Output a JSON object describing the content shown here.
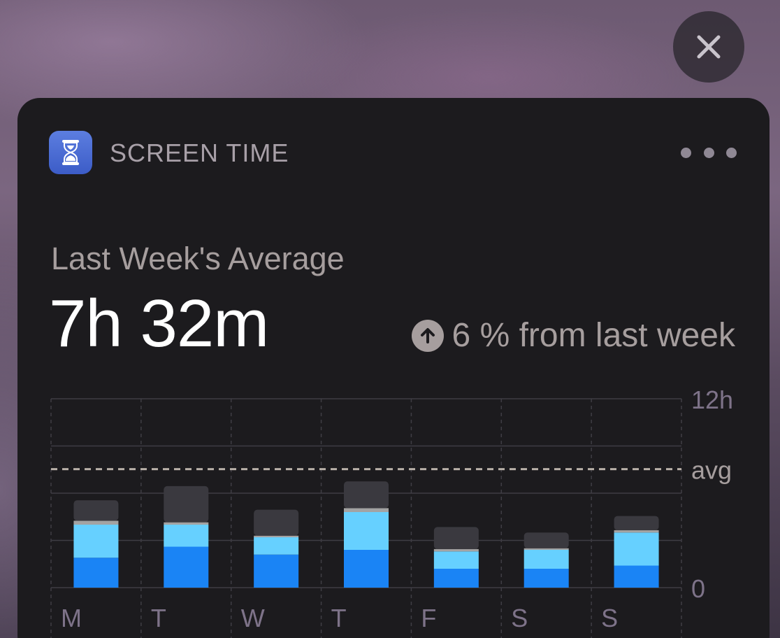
{
  "widget": {
    "app_name": "SCREEN TIME",
    "subtitle": "Last Week's Average",
    "value": "7h 32m",
    "change_text": "6 % from last week",
    "change_direction": "up",
    "icons": {
      "app": "hourglass-icon",
      "close": "close-icon",
      "more": "ellipsis-icon",
      "change": "arrow-up-circle-icon"
    }
  },
  "colors": {
    "accent_dark_blue": "#1a84f5",
    "accent_light_blue": "#66d0ff",
    "other_gray": "#a3a3a3",
    "remainder": "#3a393f"
  },
  "chart_data": {
    "type": "bar",
    "categories": [
      "M",
      "T",
      "W",
      "T",
      "F",
      "S",
      "S"
    ],
    "series": [
      {
        "values": [
          1.9,
          2.6,
          2.1,
          2.4,
          1.2,
          1.2,
          1.4
        ]
      },
      {
        "values": [
          2.1,
          1.4,
          1.1,
          2.4,
          1.1,
          1.2,
          2.1
        ]
      },
      {
        "values": [
          0.25,
          0.15,
          0.1,
          0.25,
          0.15,
          0.1,
          0.15
        ]
      },
      {
        "values": [
          1.3,
          2.3,
          1.65,
          1.7,
          1.4,
          1.0,
          0.9
        ]
      }
    ],
    "ylim": [
      0,
      12
    ],
    "y_tick_labels": [
      "12h",
      "0"
    ],
    "average_line": {
      "label": "avg",
      "value": 7.53
    },
    "grid": true
  }
}
